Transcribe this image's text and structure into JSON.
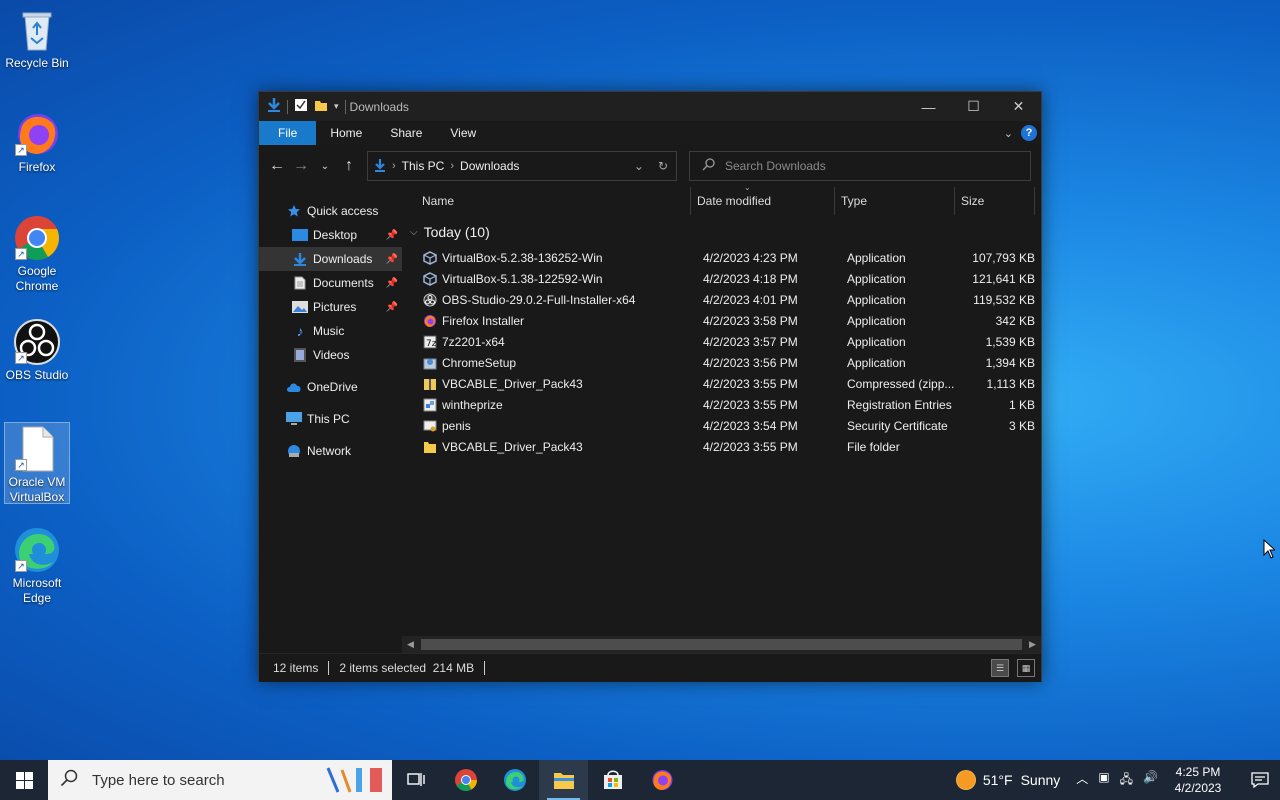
{
  "desktop": {
    "icons": [
      {
        "label": "Recycle Bin"
      },
      {
        "label": "Firefox"
      },
      {
        "label": "Google Chrome"
      },
      {
        "label": "OBS Studio"
      },
      {
        "label": "Oracle VM VirtualBox"
      },
      {
        "label": "Microsoft Edge"
      }
    ]
  },
  "window": {
    "title": "Downloads",
    "ribbon_tabs": [
      "File",
      "Home",
      "Share",
      "View"
    ],
    "breadcrumb": [
      "This PC",
      "Downloads"
    ],
    "search_placeholder": "Search Downloads",
    "nav_pane": {
      "quick_access": "Quick access",
      "items": [
        {
          "label": "Desktop",
          "pinned": true
        },
        {
          "label": "Downloads",
          "pinned": true,
          "selected": true
        },
        {
          "label": "Documents",
          "pinned": true
        },
        {
          "label": "Pictures",
          "pinned": true
        },
        {
          "label": "Music"
        },
        {
          "label": "Videos"
        }
      ],
      "onedrive": "OneDrive",
      "this_pc": "This PC",
      "network": "Network"
    },
    "columns": {
      "name": "Name",
      "date": "Date modified",
      "type": "Type",
      "size": "Size"
    },
    "group_label": "Today (10)",
    "files": [
      {
        "name": "VirtualBox-5.2.38-136252-Win",
        "date": "4/2/2023 4:23 PM",
        "type": "Application",
        "size": "107,793 KB",
        "icon": "virtualbox-icon"
      },
      {
        "name": "VirtualBox-5.1.38-122592-Win",
        "date": "4/2/2023 4:18 PM",
        "type": "Application",
        "size": "121,641 KB",
        "icon": "virtualbox-icon"
      },
      {
        "name": "OBS-Studio-29.0.2-Full-Installer-x64",
        "date": "4/2/2023 4:01 PM",
        "type": "Application",
        "size": "119,532 KB",
        "icon": "obs-icon"
      },
      {
        "name": "Firefox Installer",
        "date": "4/2/2023 3:58 PM",
        "type": "Application",
        "size": "342 KB",
        "icon": "firefox-icon"
      },
      {
        "name": "7z2201-x64",
        "date": "4/2/2023 3:57 PM",
        "type": "Application",
        "size": "1,539 KB",
        "icon": "7zip-icon"
      },
      {
        "name": "ChromeSetup",
        "date": "4/2/2023 3:56 PM",
        "type": "Application",
        "size": "1,394 KB",
        "icon": "installer-icon"
      },
      {
        "name": "VBCABLE_Driver_Pack43",
        "date": "4/2/2023 3:55 PM",
        "type": "Compressed (zipp...",
        "size": "1,113 KB",
        "icon": "zip-folder-icon"
      },
      {
        "name": "wintheprize",
        "date": "4/2/2023 3:55 PM",
        "type": "Registration Entries",
        "size": "1 KB",
        "icon": "registry-icon"
      },
      {
        "name": "penis",
        "date": "4/2/2023 3:54 PM",
        "type": "Security Certificate",
        "size": "3 KB",
        "icon": "certificate-icon"
      },
      {
        "name": "VBCABLE_Driver_Pack43",
        "date": "4/2/2023 3:55 PM",
        "type": "File folder",
        "size": "",
        "icon": "folder-icon"
      }
    ],
    "status": {
      "count": "12 items",
      "selection": "2 items selected  214 MB"
    }
  },
  "taskbar": {
    "search_placeholder": "Type here to search",
    "apps": [
      "task-view-icon",
      "chrome-icon",
      "edge-icon",
      "file-explorer-icon",
      "store-icon",
      "firefox-icon"
    ],
    "weather": {
      "temp": "51°F",
      "condition": "Sunny"
    },
    "clock": {
      "time": "4:25 PM",
      "date": "4/2/2023"
    }
  },
  "colors": {
    "accent": "#1979ca",
    "window_bg": "#191919",
    "taskbar_bg": "#1c2634"
  }
}
